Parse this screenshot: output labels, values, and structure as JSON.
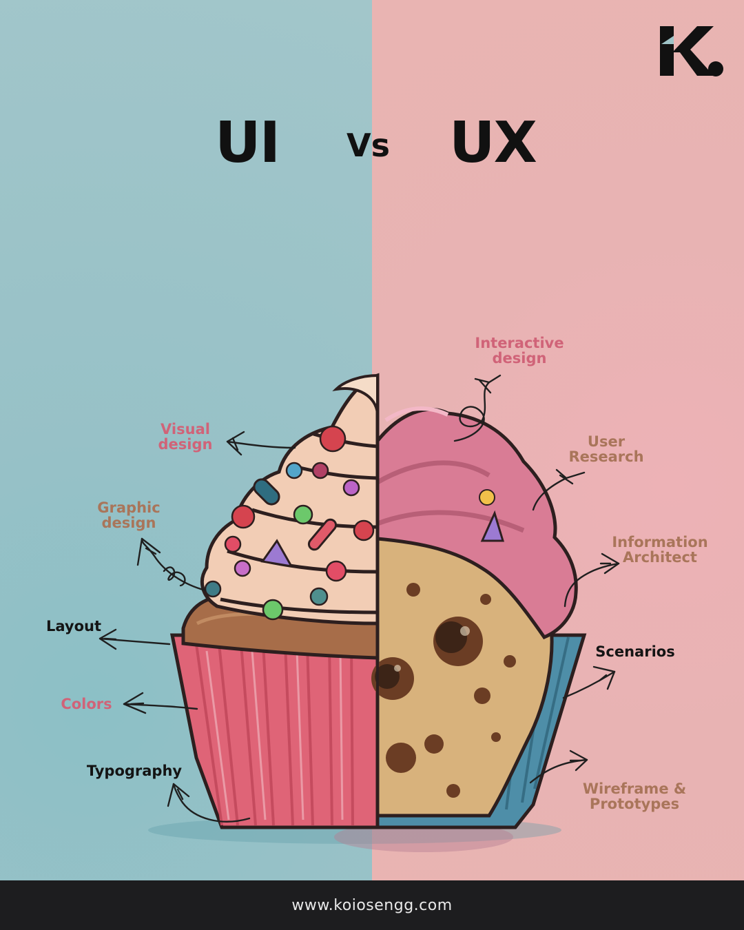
{
  "title": {
    "left": "UI",
    "middle": "Vs",
    "right": "UX"
  },
  "labels": {
    "visual_design": "Visual\ndesign",
    "graphic_design": "Graphic\ndesign",
    "layout": "Layout",
    "colors": "Colors",
    "typography": "Typography",
    "interactive_design": "Interactive\ndesign",
    "user_research": "User\nResearch",
    "information_architect": "Information\nArchitect",
    "scenarios": "Scenarios",
    "wireframe_prototypes": "Wireframe &\nPrototypes"
  },
  "footer": {
    "url": "www.koiosengg.com"
  },
  "colors": {
    "left_background": "#9fc4c8",
    "right_background": "#e9b4b2",
    "pink_label": "#d06378",
    "brown_label": "#a9755a",
    "dark_label": "#141414",
    "footer_background": "#1d1d1f"
  },
  "icons": {
    "logo": "k-dot-logo",
    "illustration": "split-cupcake"
  }
}
